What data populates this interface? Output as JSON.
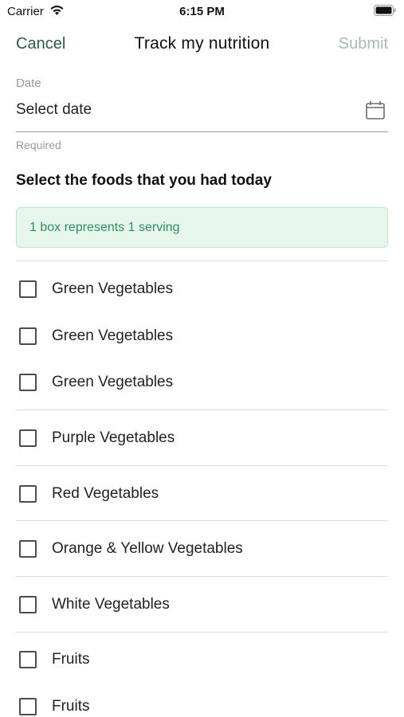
{
  "status_bar": {
    "carrier": "Carrier",
    "time": "6:15 PM",
    "icons": [
      "wifi-icon",
      "battery-icon"
    ]
  },
  "nav": {
    "cancel_label": "Cancel",
    "title": "Track my nutrition",
    "submit_label": "Submit"
  },
  "date": {
    "label": "Date",
    "placeholder": "Select date",
    "helper": "Required",
    "icon": "calendar-icon"
  },
  "section": {
    "heading": "Select the foods that you had today",
    "info": "1 box represents 1 serving"
  },
  "foods": [
    {
      "label": "Green Vegetables",
      "checked": false
    },
    {
      "label": "Green Vegetables",
      "checked": false
    },
    {
      "label": "Green Vegetables",
      "checked": false
    },
    {
      "label": "Purple Vegetables",
      "checked": false
    },
    {
      "label": "Red Vegetables",
      "checked": false
    },
    {
      "label": "Orange & Yellow Vegetables",
      "checked": false
    },
    {
      "label": "White Vegetables",
      "checked": false
    },
    {
      "label": "Fruits",
      "checked": false
    },
    {
      "label": "Fruits",
      "checked": false
    }
  ],
  "colors": {
    "accent": "#2e5a45",
    "submit_disabled": "#a5bdb1",
    "info_bg": "#e6f6ec",
    "info_text": "#2f8f5a"
  }
}
